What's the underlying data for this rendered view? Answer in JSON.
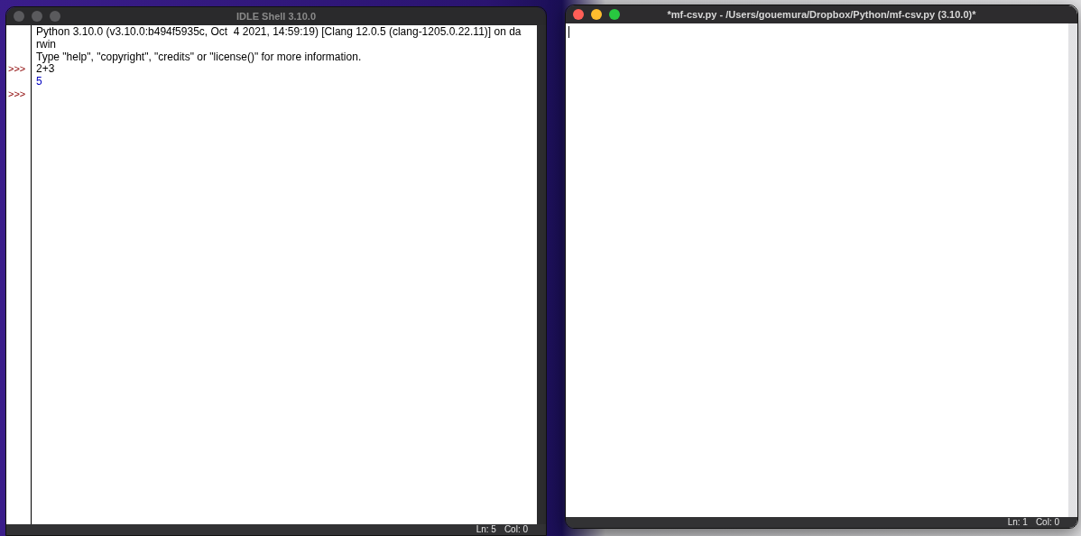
{
  "windows": [
    {
      "kind": "shell",
      "title": "IDLE Shell 3.10.0",
      "focused": false,
      "lines": [
        {
          "text": "Python 3.10.0 (v3.10.0:b494f5935c, Oct  4 2021, 14:59:19) [Clang 12.0.5 (clang-1205.0.22.11)] on da",
          "kind": "banner"
        },
        {
          "text": "rwin",
          "kind": "banner"
        },
        {
          "text": "Type \"help\", \"copyright\", \"credits\" or \"license()\" for more information.",
          "kind": "banner"
        },
        {
          "prompt": ">>>",
          "text": "2+3",
          "kind": "input"
        },
        {
          "text": "5",
          "kind": "result"
        },
        {
          "prompt": ">>>",
          "kind": "input"
        }
      ],
      "status": {
        "line": "Ln: 5",
        "col": "Col: 0"
      }
    },
    {
      "kind": "editor",
      "title": "*mf-csv.py - /Users/gouemura/Dropbox/Python/mf-csv.py (3.10.0)*",
      "focused": true,
      "status": {
        "line": "Ln: 1",
        "col": "Col: 0"
      }
    }
  ]
}
